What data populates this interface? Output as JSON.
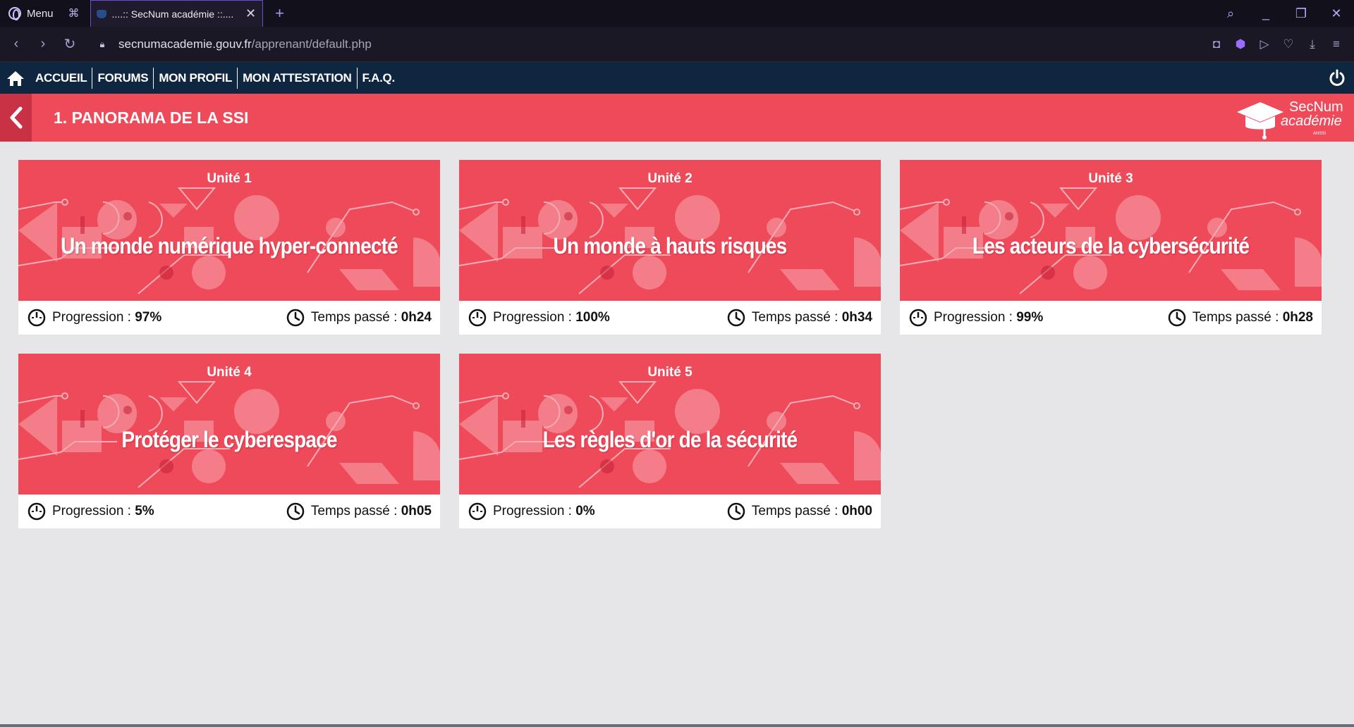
{
  "browser": {
    "menu_label": "Menu",
    "tab_title": "....:: SecNum académie ::....",
    "url_host": "secnumacademie.gouv.fr",
    "url_path": "/apprenant/default.php",
    "accent": "#6b4fd0"
  },
  "nav": {
    "links": [
      "ACCUEIL",
      "FORUMS",
      "MON PROFIL",
      "MON ATTESTATION",
      "F.A.Q."
    ],
    "background": "#0e263f"
  },
  "section": {
    "title": "1. PANORAMA DE LA SSI",
    "color": "#ef4a5a",
    "brand_line1": "SecNum",
    "brand_line2": "académie",
    "brand_tiny": "ANSSI"
  },
  "units": [
    {
      "label": "Unité 1",
      "title": "Un monde numérique hyper-connecté",
      "progress_label": "Progression : ",
      "progress": "97%",
      "time_label": "Temps passé : ",
      "time": "0h24"
    },
    {
      "label": "Unité 2",
      "title": "Un monde à hauts risques",
      "progress_label": "Progression : ",
      "progress": "100%",
      "time_label": "Temps passé : ",
      "time": "0h34"
    },
    {
      "label": "Unité 3",
      "title": "Les acteurs de la cybersécurité",
      "progress_label": "Progression : ",
      "progress": "99%",
      "time_label": "Temps passé : ",
      "time": "0h28"
    },
    {
      "label": "Unité 4",
      "title": "Protéger le cyberespace",
      "progress_label": "Progression : ",
      "progress": "5%",
      "time_label": "Temps passé : ",
      "time": "0h05"
    },
    {
      "label": "Unité 5",
      "title": "Les règles d'or de la sécurité",
      "progress_label": "Progression : ",
      "progress": "0%",
      "time_label": "Temps passé : ",
      "time": "0h00"
    }
  ]
}
